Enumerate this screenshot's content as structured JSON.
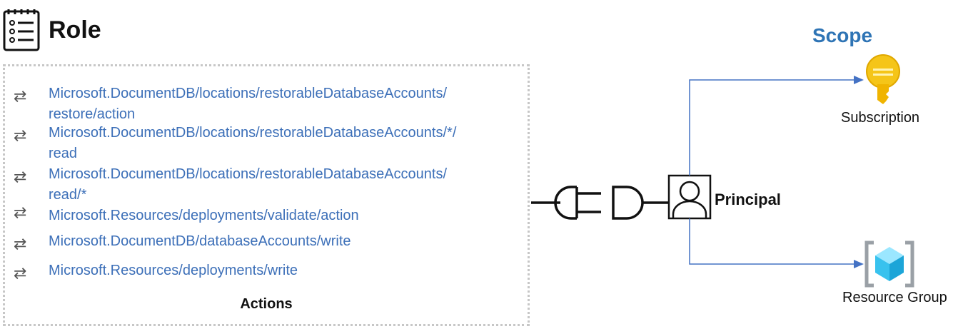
{
  "role": {
    "title": "Role",
    "icon": "list-icon"
  },
  "actions": {
    "label": "Actions",
    "items": [
      {
        "icon": "swap-arrows-icon",
        "text": "Microsoft.DocumentDB/locations/restorableDatabaseAccounts/\nrestore/action"
      },
      {
        "icon": "swap-arrows-icon",
        "text": "Microsoft.DocumentDB/locations/restorableDatabaseAccounts/*/\nread"
      },
      {
        "icon": "swap-arrows-icon",
        "text": "Microsoft.DocumentDB/locations/restorableDatabaseAccounts/\nread/*"
      },
      {
        "icon": "swap-arrows-icon",
        "text": "Microsoft.Resources/deployments/validate/action"
      },
      {
        "icon": "swap-arrows-icon",
        "text": "Microsoft.DocumentDB/databaseAccounts/write"
      },
      {
        "icon": "swap-arrows-icon",
        "text": "Microsoft.Resources/deployments/write"
      }
    ]
  },
  "principal": {
    "label": "Principal",
    "icon": "user-icon"
  },
  "scope": {
    "title": "Scope",
    "subscription": {
      "label": "Subscription",
      "icon": "key-icon"
    },
    "resource_group": {
      "label": "Resource Group",
      "icon": "resource-group-icon"
    }
  },
  "colors": {
    "link_text": "#3c6fb8",
    "scope_title": "#2e74b5",
    "connector_line": "#4472c4",
    "key": "#f5c518",
    "cube": "#50c8f0"
  }
}
